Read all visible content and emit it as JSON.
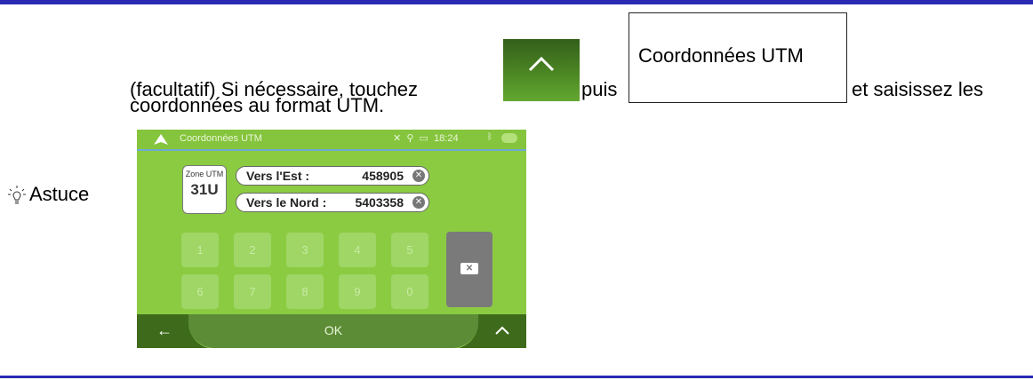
{
  "instruction": {
    "prefix": "(facultatif) Si nécessaire, touchez",
    "puis": "puis",
    "button_label": "Coordonnées UTM",
    "suffix": "et saisissez les",
    "line2": "coordonnées au format UTM."
  },
  "tip": {
    "label": "Astuce",
    "icon": "lightbulb-icon"
  },
  "device": {
    "header_title": "Coordonnées UTM",
    "status_time": "18:24",
    "zone_label": "Zone UTM",
    "zone_value": "31U",
    "fields": [
      {
        "label": "Vers l'Est :",
        "value": "458905"
      },
      {
        "label": "Vers le Nord :",
        "value": "5403358"
      }
    ],
    "keys_row1": [
      "1",
      "2",
      "3",
      "4",
      "5"
    ],
    "keys_row2": [
      "6",
      "7",
      "8",
      "9",
      "0"
    ],
    "ok_label": "OK"
  },
  "colors": {
    "rule": "#2a2ab4",
    "device_green": "#8bcb42",
    "button_green": "#4e8a24"
  }
}
